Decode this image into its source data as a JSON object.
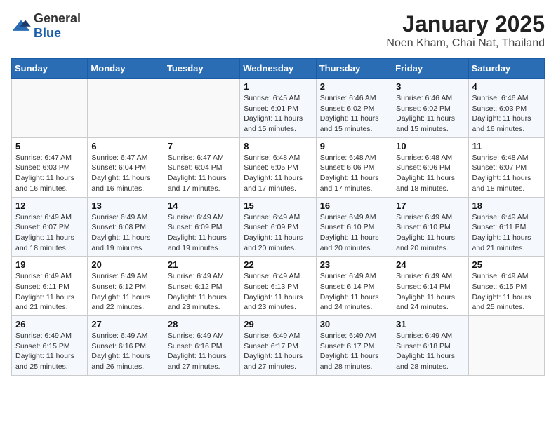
{
  "header": {
    "logo_general": "General",
    "logo_blue": "Blue",
    "title": "January 2025",
    "subtitle": "Noen Kham, Chai Nat, Thailand"
  },
  "weekdays": [
    "Sunday",
    "Monday",
    "Tuesday",
    "Wednesday",
    "Thursday",
    "Friday",
    "Saturday"
  ],
  "weeks": [
    [
      {
        "day": "",
        "info": ""
      },
      {
        "day": "",
        "info": ""
      },
      {
        "day": "",
        "info": ""
      },
      {
        "day": "1",
        "info": "Sunrise: 6:45 AM\nSunset: 6:01 PM\nDaylight: 11 hours and 15 minutes."
      },
      {
        "day": "2",
        "info": "Sunrise: 6:46 AM\nSunset: 6:02 PM\nDaylight: 11 hours and 15 minutes."
      },
      {
        "day": "3",
        "info": "Sunrise: 6:46 AM\nSunset: 6:02 PM\nDaylight: 11 hours and 15 minutes."
      },
      {
        "day": "4",
        "info": "Sunrise: 6:46 AM\nSunset: 6:03 PM\nDaylight: 11 hours and 16 minutes."
      }
    ],
    [
      {
        "day": "5",
        "info": "Sunrise: 6:47 AM\nSunset: 6:03 PM\nDaylight: 11 hours and 16 minutes."
      },
      {
        "day": "6",
        "info": "Sunrise: 6:47 AM\nSunset: 6:04 PM\nDaylight: 11 hours and 16 minutes."
      },
      {
        "day": "7",
        "info": "Sunrise: 6:47 AM\nSunset: 6:04 PM\nDaylight: 11 hours and 17 minutes."
      },
      {
        "day": "8",
        "info": "Sunrise: 6:48 AM\nSunset: 6:05 PM\nDaylight: 11 hours and 17 minutes."
      },
      {
        "day": "9",
        "info": "Sunrise: 6:48 AM\nSunset: 6:06 PM\nDaylight: 11 hours and 17 minutes."
      },
      {
        "day": "10",
        "info": "Sunrise: 6:48 AM\nSunset: 6:06 PM\nDaylight: 11 hours and 18 minutes."
      },
      {
        "day": "11",
        "info": "Sunrise: 6:48 AM\nSunset: 6:07 PM\nDaylight: 11 hours and 18 minutes."
      }
    ],
    [
      {
        "day": "12",
        "info": "Sunrise: 6:49 AM\nSunset: 6:07 PM\nDaylight: 11 hours and 18 minutes."
      },
      {
        "day": "13",
        "info": "Sunrise: 6:49 AM\nSunset: 6:08 PM\nDaylight: 11 hours and 19 minutes."
      },
      {
        "day": "14",
        "info": "Sunrise: 6:49 AM\nSunset: 6:09 PM\nDaylight: 11 hours and 19 minutes."
      },
      {
        "day": "15",
        "info": "Sunrise: 6:49 AM\nSunset: 6:09 PM\nDaylight: 11 hours and 20 minutes."
      },
      {
        "day": "16",
        "info": "Sunrise: 6:49 AM\nSunset: 6:10 PM\nDaylight: 11 hours and 20 minutes."
      },
      {
        "day": "17",
        "info": "Sunrise: 6:49 AM\nSunset: 6:10 PM\nDaylight: 11 hours and 20 minutes."
      },
      {
        "day": "18",
        "info": "Sunrise: 6:49 AM\nSunset: 6:11 PM\nDaylight: 11 hours and 21 minutes."
      }
    ],
    [
      {
        "day": "19",
        "info": "Sunrise: 6:49 AM\nSunset: 6:11 PM\nDaylight: 11 hours and 21 minutes."
      },
      {
        "day": "20",
        "info": "Sunrise: 6:49 AM\nSunset: 6:12 PM\nDaylight: 11 hours and 22 minutes."
      },
      {
        "day": "21",
        "info": "Sunrise: 6:49 AM\nSunset: 6:12 PM\nDaylight: 11 hours and 23 minutes."
      },
      {
        "day": "22",
        "info": "Sunrise: 6:49 AM\nSunset: 6:13 PM\nDaylight: 11 hours and 23 minutes."
      },
      {
        "day": "23",
        "info": "Sunrise: 6:49 AM\nSunset: 6:14 PM\nDaylight: 11 hours and 24 minutes."
      },
      {
        "day": "24",
        "info": "Sunrise: 6:49 AM\nSunset: 6:14 PM\nDaylight: 11 hours and 24 minutes."
      },
      {
        "day": "25",
        "info": "Sunrise: 6:49 AM\nSunset: 6:15 PM\nDaylight: 11 hours and 25 minutes."
      }
    ],
    [
      {
        "day": "26",
        "info": "Sunrise: 6:49 AM\nSunset: 6:15 PM\nDaylight: 11 hours and 25 minutes."
      },
      {
        "day": "27",
        "info": "Sunrise: 6:49 AM\nSunset: 6:16 PM\nDaylight: 11 hours and 26 minutes."
      },
      {
        "day": "28",
        "info": "Sunrise: 6:49 AM\nSunset: 6:16 PM\nDaylight: 11 hours and 27 minutes."
      },
      {
        "day": "29",
        "info": "Sunrise: 6:49 AM\nSunset: 6:17 PM\nDaylight: 11 hours and 27 minutes."
      },
      {
        "day": "30",
        "info": "Sunrise: 6:49 AM\nSunset: 6:17 PM\nDaylight: 11 hours and 28 minutes."
      },
      {
        "day": "31",
        "info": "Sunrise: 6:49 AM\nSunset: 6:18 PM\nDaylight: 11 hours and 28 minutes."
      },
      {
        "day": "",
        "info": ""
      }
    ]
  ]
}
